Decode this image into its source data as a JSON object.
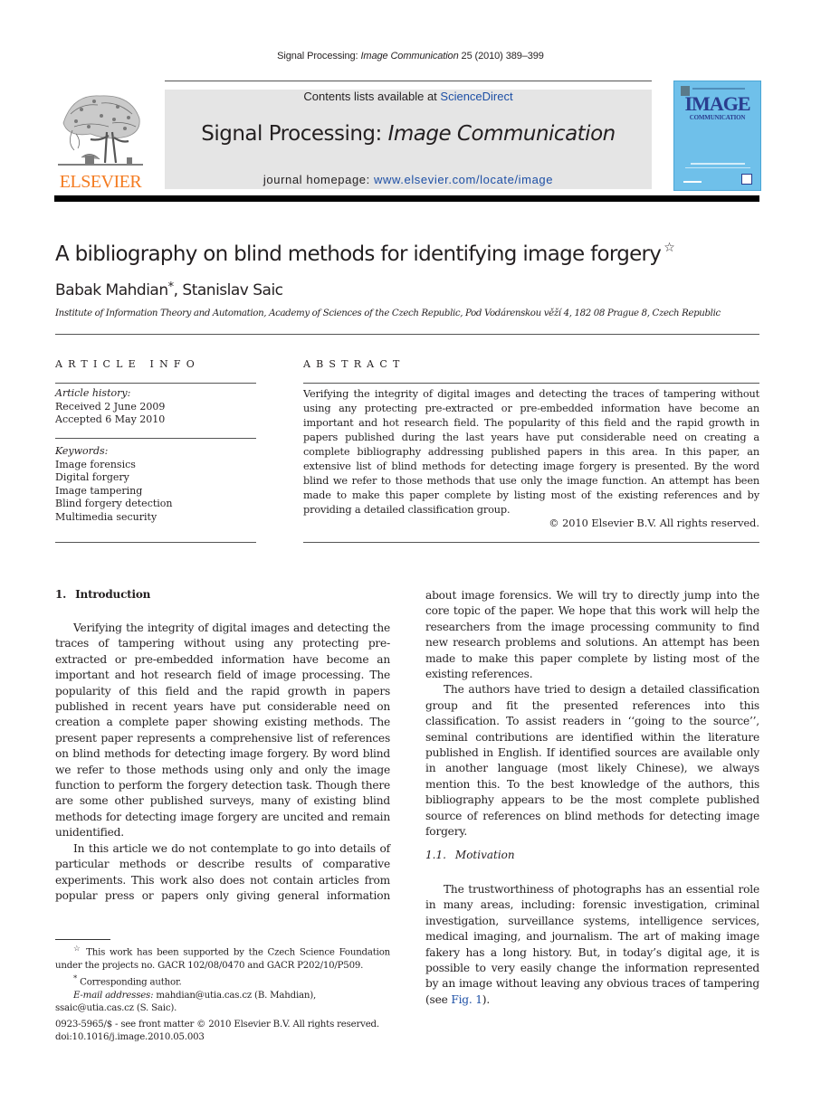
{
  "running_head": {
    "journal_plain": "Signal Processing: ",
    "journal_italic": "Image Communication",
    "citation": " 25 (2010) 389–399"
  },
  "header": {
    "publisher_logo_text": "ELSEVIER",
    "contents_prefix": "Contents lists available at ",
    "contents_link": "ScienceDirect",
    "journal_title_plain": "Signal Processing: ",
    "journal_title_italic": "Image Communication",
    "homepage_prefix": "journal homepage: ",
    "homepage_link": "www.elsevier.com/locate/image",
    "cover_title": "IMAGE",
    "cover_subtitle": "COMMUNICATION",
    "colors": {
      "brand_orange": "#f47b20",
      "link_blue": "#1d4fa5",
      "cover_blue": "#6fc0ea",
      "cover_title": "#2a3d8f",
      "banner_gray": "#e5e5e5"
    }
  },
  "article": {
    "title": "A bibliography on blind methods for identifying image forgery",
    "title_note_mark": "☆",
    "author1": "Babak Mahdian",
    "author1_mark": "*",
    "author_sep": ", ",
    "author2": "Stanislav Saic",
    "affiliation": "Institute of Information Theory and Automation, Academy of Sciences of the Czech Republic, Pod Vodárenskou věží 4, 182 08 Prague 8, Czech Republic"
  },
  "article_info": {
    "heading": "ARTICLE INFO",
    "history_label": "Article history:",
    "received": "Received 2 June 2009",
    "accepted": "Accepted 6 May 2010",
    "keywords_label": "Keywords:",
    "keywords": [
      "Image forensics",
      "Digital forgery",
      "Image tampering",
      "Blind forgery detection",
      "Multimedia security"
    ]
  },
  "abstract": {
    "heading": "ABSTRACT",
    "text": "Verifying the integrity of digital images and detecting the traces of tampering without using any protecting pre-extracted or pre-embedded information have become an important and hot research field. The popularity of this field and the rapid growth in papers published during the last years have put considerable need on creating a complete bibliography addressing published papers in this area. In this paper, an extensive list of blind methods for detecting image forgery is presented. By the word blind we refer to those methods that use only the image function. An attempt has been made to make this paper complete by listing most of the existing references and by providing a detailed classification group.",
    "copyright": "© 2010 Elsevier B.V. All rights reserved."
  },
  "body": {
    "section1_number": "1.",
    "section1_title": "Introduction",
    "intro_p1": "Verifying the integrity of digital images and detecting the traces of tampering without using any protecting pre-extracted or pre-embedded information have become an important and hot research field of image processing. The popularity of this field and the rapid growth in papers published in recent years have put considerable need on creation a complete paper showing existing methods. The present paper represents a comprehensive list of references on blind methods for detecting image forgery. By word blind we refer to those methods using only and only the image function to perform the forgery detection task. Though there are some other published surveys, many of existing blind methods for detecting image forgery are uncited and remain unidentified.",
    "intro_p2_left": "In this article we do not contemplate to go into details of particular methods or describe results of comparative experiments. This work also does not contain articles from popular press or papers only giving general information",
    "intro_p2_right": "about image forensics. We will try to directly jump into the core topic of the paper. We hope that this work will help the researchers from the image processing community to find new research problems and solutions. An attempt has been made to make this paper complete by listing most of the existing references.",
    "intro_p3": "The authors have tried to design a detailed classification group and fit the presented references into this classification. To assist readers in ‘‘going to the source’’, seminal contributions are identified within the literature published in English. If identified sources are available only in another language (most likely Chinese), we always mention this. To the best knowledge of the authors, this bibliography appears to be the most complete published source of references on blind methods for detecting image forgery.",
    "section11_number": "1.1.",
    "section11_title": "Motivation",
    "motivation_p1_pre": "The trustworthiness of photographs has an essential role in many areas, including: forensic investigation, criminal investigation, surveillance systems, intelligence services, medical imaging, and journalism. The art of making image fakery has a long history. But, in today’s digital age, it is possible to very easily change the information represented by an image without leaving any obvious traces of tampering (see ",
    "motivation_fig_link": "Fig. 1",
    "motivation_p1_post": ")."
  },
  "footnotes": {
    "funding_mark": "☆",
    "funding": " This work has been supported by the Czech Science Foundation under the projects no. GACR 102/08/0470 and GACR P202/10/P509.",
    "corresponding_mark": "*",
    "corresponding": " Corresponding author.",
    "email_label": "E-mail addresses:",
    "email_1": " mahdian@utia.cas.cz (B. Mahdian),",
    "email_2": "ssaic@utia.cas.cz (S. Saic).",
    "issn_line": "0923-5965/$ - see front matter © 2010 Elsevier B.V. All rights reserved.",
    "doi": "doi:10.1016/j.image.2010.05.003"
  }
}
